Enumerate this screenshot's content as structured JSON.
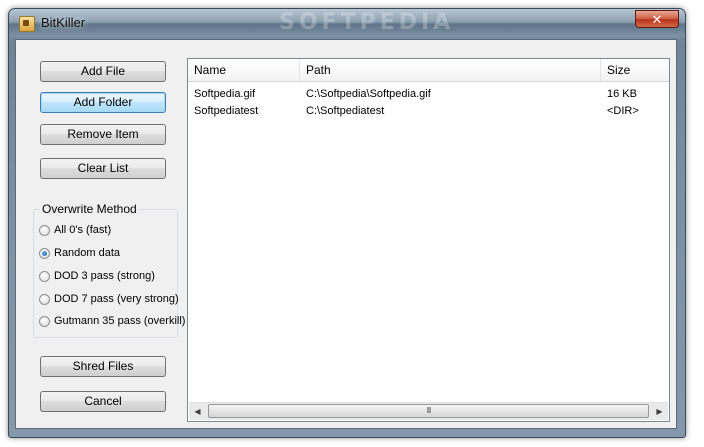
{
  "window": {
    "title": "BitKiller",
    "close_glyph": "✕",
    "watermark": "SOFTPEDIA"
  },
  "buttons": {
    "add_file": "Add File",
    "add_folder": "Add Folder",
    "remove_item": "Remove Item",
    "clear_list": "Clear List",
    "shred_files": "Shred Files",
    "cancel": "Cancel"
  },
  "overwrite": {
    "label": "Overwrite Method",
    "selected_index": 1,
    "options": [
      {
        "label": "All 0's (fast)",
        "checked": false
      },
      {
        "label": "Random data",
        "checked": true
      },
      {
        "label": "DOD 3 pass (strong)",
        "checked": false
      },
      {
        "label": "DOD 7 pass (very strong)",
        "checked": false
      },
      {
        "label": "Gutmann 35 pass (overkill)",
        "checked": false
      }
    ]
  },
  "file_list": {
    "columns": [
      "Name",
      "Path",
      "Size"
    ],
    "rows": [
      {
        "name": "Softpedia.gif",
        "path": "C:\\Softpedia\\Softpedia.gif",
        "size": "16 KB"
      },
      {
        "name": "Softpediatest",
        "path": "C:\\Softpediatest",
        "size": "<DIR>"
      }
    ]
  },
  "scrollbar": {
    "left_arrow": "◀",
    "right_arrow": "▶",
    "grip": "III"
  },
  "icons": {
    "app": "bitkiller-app-icon",
    "close": "close-icon"
  }
}
